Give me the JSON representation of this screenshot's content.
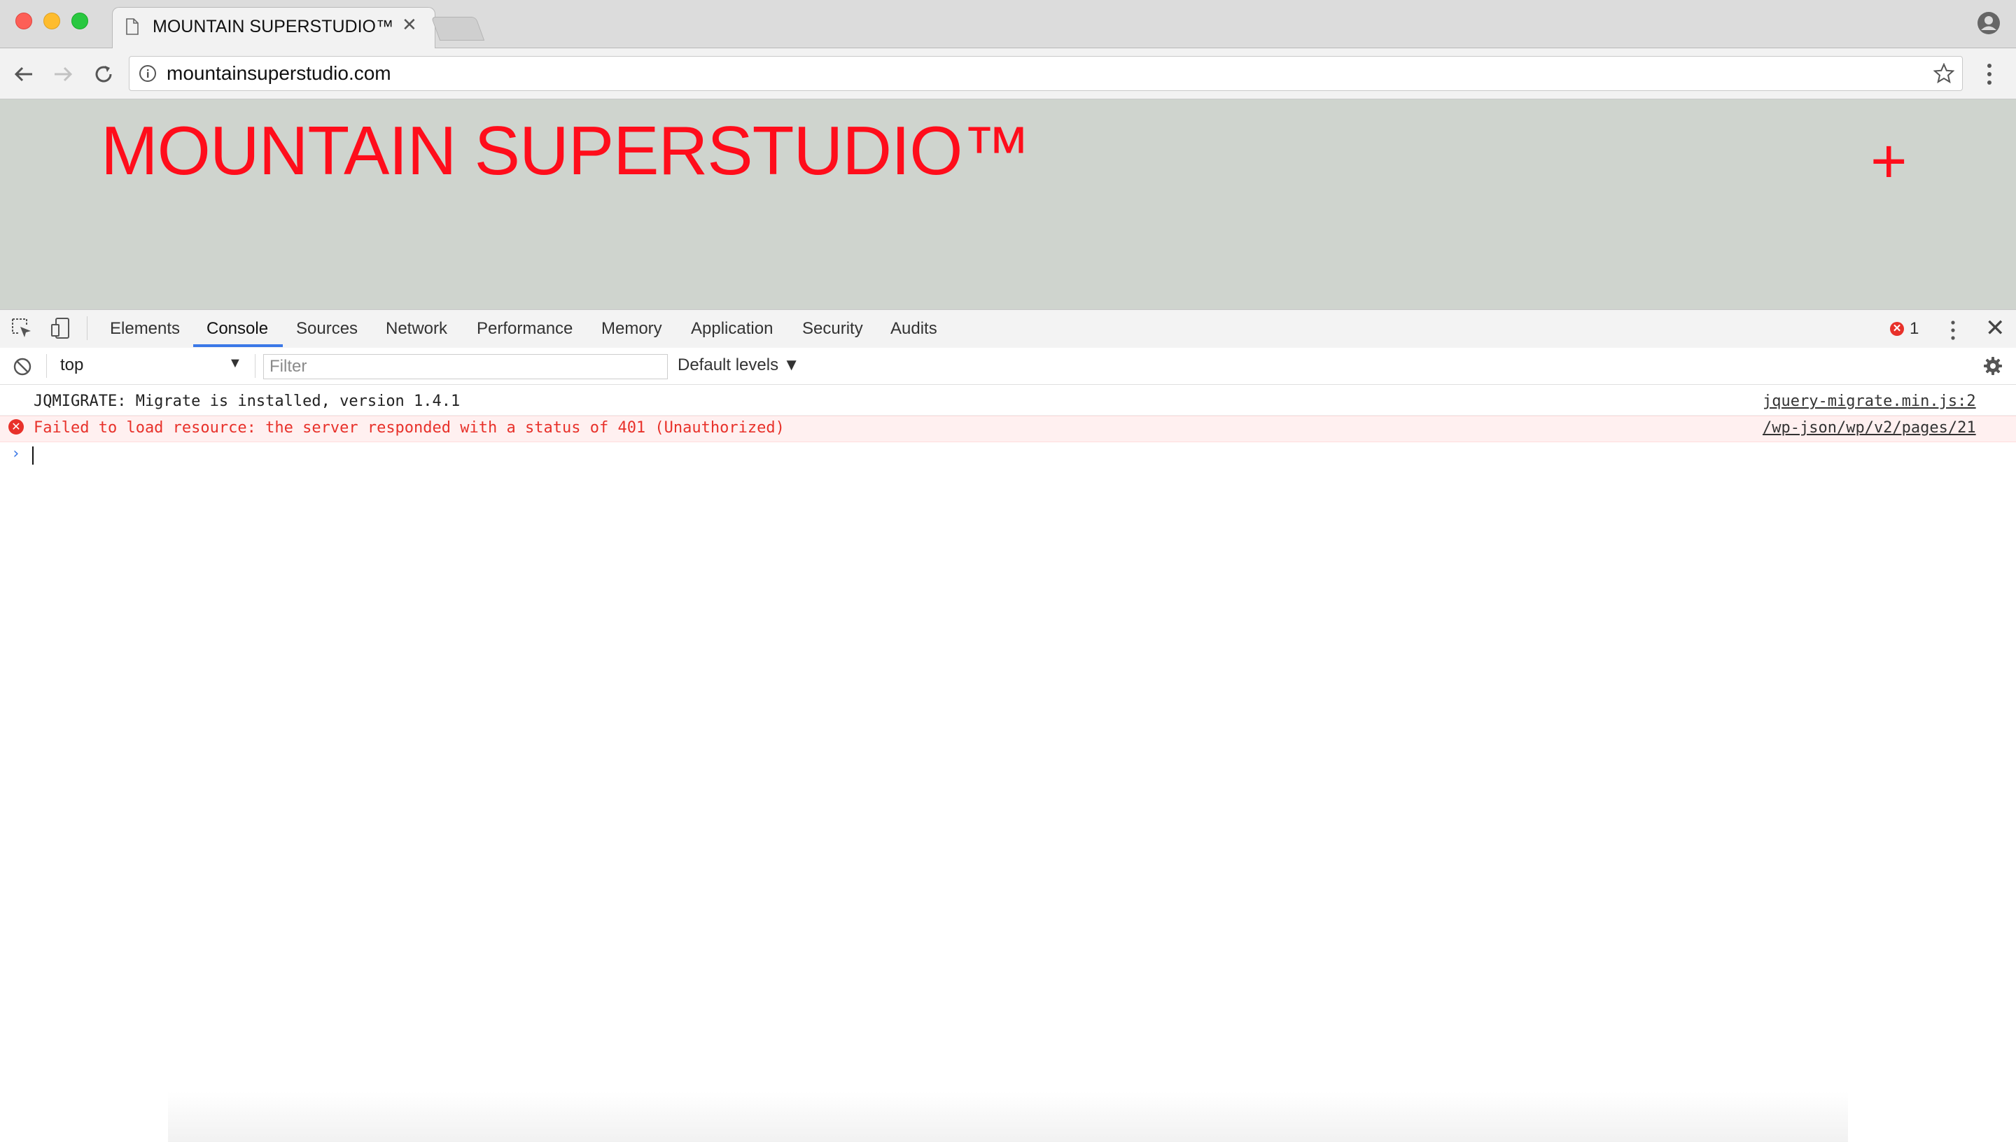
{
  "browser": {
    "tab_title": "MOUNTAIN SUPERSTUDIO™",
    "tab_close": "✕",
    "url": "mountainsuperstudio.com"
  },
  "page": {
    "site_title": "MOUNTAIN SUPERSTUDIO™",
    "plus_label": "+",
    "brand_color": "#ff0d1b",
    "background_color": "#cfd4ce"
  },
  "devtools": {
    "tabs": [
      {
        "label": "Elements"
      },
      {
        "label": "Console",
        "active": true
      },
      {
        "label": "Sources"
      },
      {
        "label": "Network"
      },
      {
        "label": "Performance"
      },
      {
        "label": "Memory"
      },
      {
        "label": "Application"
      },
      {
        "label": "Security"
      },
      {
        "label": "Audits"
      }
    ],
    "error_count": "1",
    "close_label": "✕",
    "console": {
      "context": "top",
      "filter_placeholder": "Filter",
      "levels_label": "Default levels ▼",
      "messages": [
        {
          "level": "info",
          "text": "JQMIGRATE: Migrate is installed, version 1.4.1",
          "source": "jquery-migrate.min.js:2"
        },
        {
          "level": "error",
          "text": "Failed to load resource: the server responded with a status of 401 (Unauthorized)",
          "source": "/wp-json/wp/v2/pages/21"
        }
      ],
      "prompt_symbol": "›"
    }
  },
  "icons": {
    "traffic_lights": [
      "close",
      "minimize",
      "zoom"
    ],
    "nav": [
      "back-arrow-icon",
      "forward-arrow-icon",
      "reload-icon"
    ],
    "omnibox": [
      "info-icon",
      "star-icon"
    ],
    "devtools": [
      "inspect-element-icon",
      "device-toolbar-icon",
      "kebab-menu-icon",
      "close-icon",
      "clear-console-icon",
      "gear-icon",
      "error-icon"
    ]
  }
}
